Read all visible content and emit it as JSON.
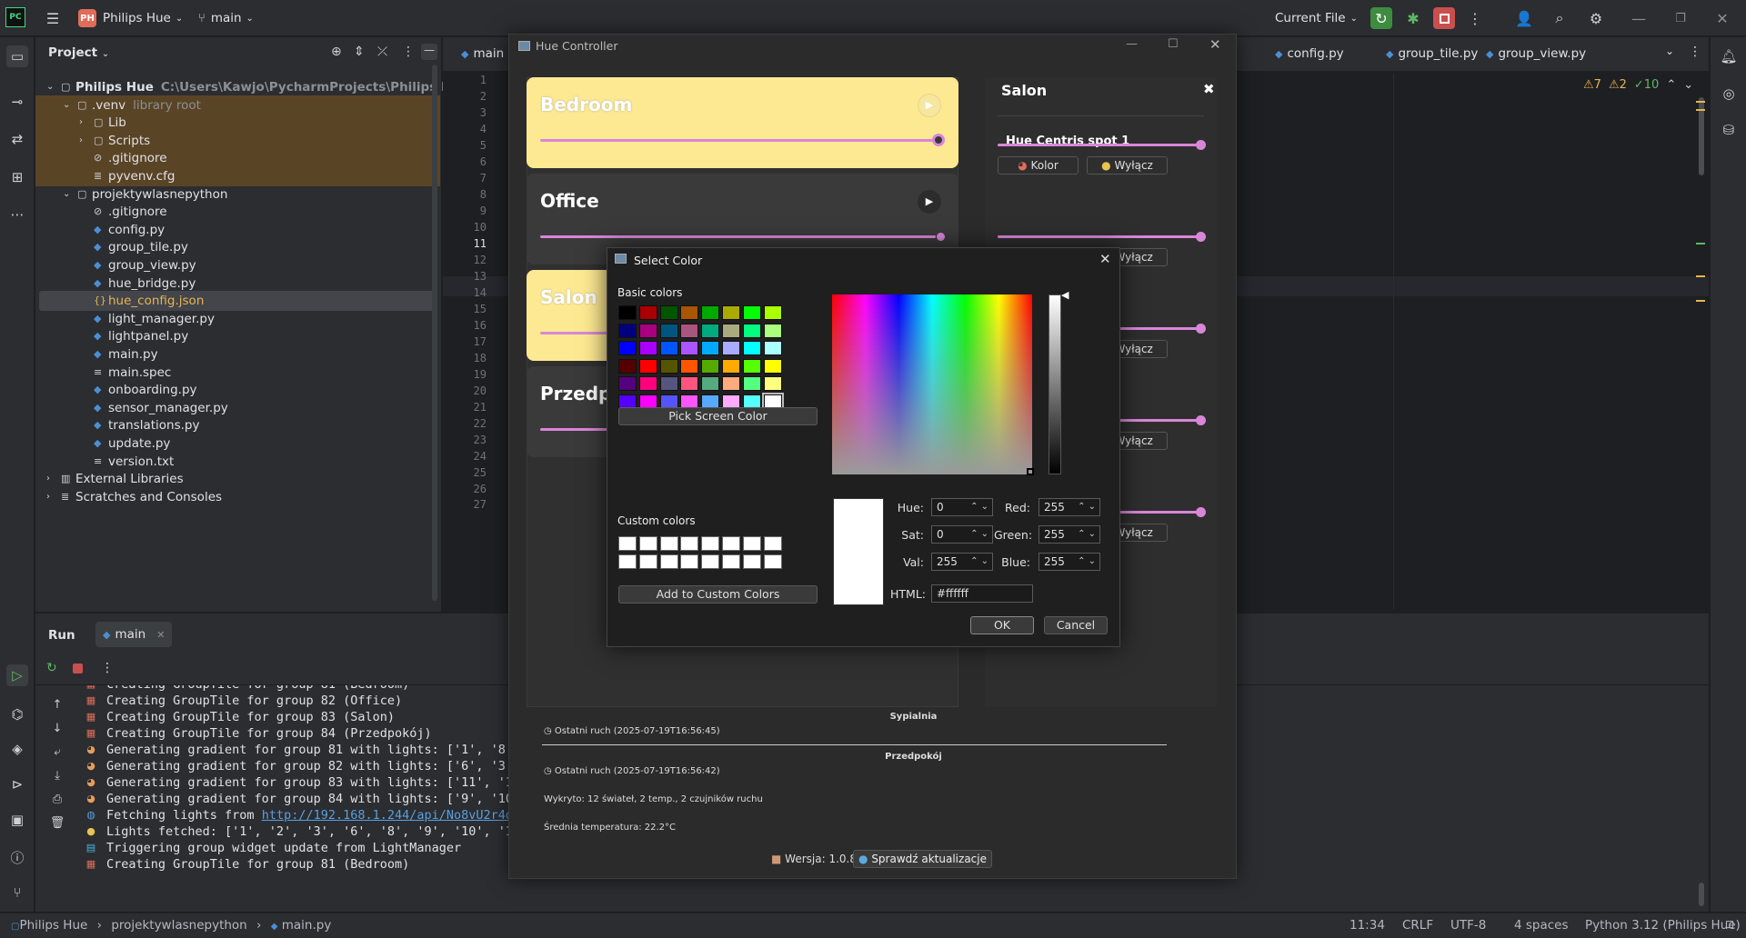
{
  "topbar": {
    "project_badge": "PH",
    "project_name": "Philips Hue",
    "branch": "main",
    "run_config": "Current File"
  },
  "project_panel": {
    "title": "Project",
    "tree": [
      {
        "label": "Philips Hue",
        "hint": "C:\\Users\\Kawjo\\PycharmProjects\\Philips Hue",
        "type": "folder",
        "depth": 0,
        "expanded": true
      },
      {
        "label": ".venv",
        "hint": "library root",
        "type": "folder",
        "depth": 1,
        "expanded": true
      },
      {
        "label": "Lib",
        "hint": "",
        "type": "folder",
        "depth": 2,
        "expanded": false
      },
      {
        "label": "Scripts",
        "hint": "",
        "type": "folder",
        "depth": 2,
        "expanded": false
      },
      {
        "label": ".gitignore",
        "hint": "",
        "type": "ignore",
        "depth": 2
      },
      {
        "label": "pyvenv.cfg",
        "hint": "",
        "type": "cfg",
        "depth": 2
      },
      {
        "label": "projektywlasnepython",
        "hint": "",
        "type": "folder",
        "depth": 1,
        "expanded": true
      },
      {
        "label": ".gitignore",
        "hint": "",
        "type": "ignore",
        "depth": 2
      },
      {
        "label": "config.py",
        "hint": "",
        "type": "py",
        "depth": 2
      },
      {
        "label": "group_tile.py",
        "hint": "",
        "type": "py",
        "depth": 2
      },
      {
        "label": "group_view.py",
        "hint": "",
        "type": "py",
        "depth": 2
      },
      {
        "label": "hue_bridge.py",
        "hint": "",
        "type": "py",
        "depth": 2
      },
      {
        "label": "hue_config.json",
        "hint": "",
        "type": "json",
        "depth": 2,
        "selected": true
      },
      {
        "label": "light_manager.py",
        "hint": "",
        "type": "py",
        "depth": 2
      },
      {
        "label": "lightpanel.py",
        "hint": "",
        "type": "py",
        "depth": 2
      },
      {
        "label": "main.py",
        "hint": "",
        "type": "py",
        "depth": 2
      },
      {
        "label": "main.spec",
        "hint": "",
        "type": "txt",
        "depth": 2
      },
      {
        "label": "onboarding.py",
        "hint": "",
        "type": "py",
        "depth": 2
      },
      {
        "label": "sensor_manager.py",
        "hint": "",
        "type": "py",
        "depth": 2
      },
      {
        "label": "translations.py",
        "hint": "",
        "type": "py",
        "depth": 2
      },
      {
        "label": "update.py",
        "hint": "",
        "type": "py",
        "depth": 2
      },
      {
        "label": "version.txt",
        "hint": "",
        "type": "txt",
        "depth": 2
      },
      {
        "label": "External Libraries",
        "hint": "",
        "type": "lib",
        "depth": 0,
        "expanded": false
      },
      {
        "label": "Scratches and Consoles",
        "hint": "",
        "type": "scratch",
        "depth": 0,
        "expanded": false
      }
    ]
  },
  "editor": {
    "tabs": [
      "main",
      "config.py",
      "group_tile.py",
      "group_view.py"
    ],
    "line_numbers": [
      "1",
      "2",
      "3",
      "4",
      "5",
      "6",
      "7",
      "8",
      "9",
      "10",
      "11",
      "12",
      "13",
      "14",
      "15",
      "16",
      "17",
      "18",
      "19",
      "20",
      "21",
      "22",
      "23",
      "24",
      "25",
      "26",
      "27"
    ],
    "current_line": "11",
    "inspections": {
      "warnings": "7",
      "weak": "2",
      "ok": "10"
    }
  },
  "run_panel": {
    "tab_run": "Run",
    "tab_config": "main",
    "log": [
      {
        "icon": "brick",
        "text": "Creating GroupTile for group 81 (Bedroom)"
      },
      {
        "icon": "brick",
        "text": "Creating GroupTile for group 82 (Office)"
      },
      {
        "icon": "brick",
        "text": "Creating GroupTile for group 83 (Salon)"
      },
      {
        "icon": "brick",
        "text": "Creating GroupTile for group 84 (Przedpokój)"
      },
      {
        "icon": "palette",
        "text": "Generating gradient for group 81 with lights: ['1', '8',"
      },
      {
        "icon": "palette",
        "text": "Generating gradient for group 82 with lights: ['6', '3'"
      },
      {
        "icon": "palette",
        "text": "Generating gradient for group 83 with lights: ['11', '1"
      },
      {
        "icon": "palette",
        "text": "Generating gradient for group 84 with lights: ['9', '10"
      },
      {
        "icon": "globe",
        "text": "Fetching lights from ",
        "link": "http://192.168.1.244/api/No8vU2r4d"
      },
      {
        "icon": "bulb",
        "text": "Lights fetched: ['1', '2', '3', '6', '8', '9', '10', '1"
      },
      {
        "icon": "update",
        "text": "Triggering group widget update from LightManager"
      },
      {
        "icon": "brick",
        "text": "Creating GroupTile for group 81 (Bedroom)"
      }
    ]
  },
  "status_bar": {
    "crumbs": [
      "Philips Hue",
      "projektywlasnepython",
      "main.py"
    ],
    "position": "11:34",
    "line_sep": "CRLF",
    "encoding": "UTF-8",
    "indent": "4 spaces",
    "interpreter": "Python 3.12 (Philips Hue)"
  },
  "hue_window": {
    "title": "Hue Controller",
    "groups": [
      {
        "name": "Bedroom",
        "on": true,
        "brightness": 1.0
      },
      {
        "name": "Office",
        "on": false,
        "brightness": 1.0
      },
      {
        "name": "Salon",
        "on": true,
        "brightness": 1.0
      },
      {
        "name": "Przedpokój",
        "on": false,
        "brightness": 1.0
      }
    ],
    "right_panel": {
      "title": "Salon",
      "close": "✖",
      "light_name": "Hue Centris spot 1",
      "color_button": "Kolor",
      "off_button": "Wyłącz"
    },
    "sensors": {
      "room1": "Sypialnia",
      "motion1": "Ostatni ruch (2025-07-19T16:56:45)",
      "room2": "Przedpokój",
      "motion2": "Ostatni ruch (2025-07-19T16:56:42)",
      "detected": "Wykryto: 12 świateł, 2 temp., 2 czujników ruchu",
      "avg_temp": "Średnia temperatura: 22.2°C"
    },
    "version": "Wersja: 1.0.8",
    "update_button": "Sprawdź aktualizacje"
  },
  "color_dialog": {
    "title": "Select Color",
    "basic_colors_label": "Basic colors",
    "basic_colors": [
      [
        "#000000",
        "#aa0000",
        "#005500",
        "#aa5500",
        "#00aa00",
        "#aaaa00",
        "#00ff00",
        "#aaff00"
      ],
      [
        "#00007f",
        "#aa007f",
        "#00557f",
        "#aa557f",
        "#00aa7f",
        "#aaaa7f",
        "#00ff7f",
        "#aaff7f"
      ],
      [
        "#0000ff",
        "#aa00ff",
        "#0055ff",
        "#aa55ff",
        "#00aaff",
        "#aaaaff",
        "#00ffff",
        "#aaffff"
      ],
      [
        "#550000",
        "#ff0000",
        "#555500",
        "#ff5500",
        "#55aa00",
        "#ffaa00",
        "#55ff00",
        "#ffff00"
      ],
      [
        "#55007f",
        "#ff007f",
        "#55557f",
        "#ff557f",
        "#55aa7f",
        "#ffaa7f",
        "#55ff7f",
        "#ffff7f"
      ],
      [
        "#5500ff",
        "#ff00ff",
        "#5555ff",
        "#ff55ff",
        "#55aaff",
        "#ffaaff",
        "#55ffff",
        "#ffffff"
      ]
    ],
    "pick_screen": "Pick Screen Color",
    "custom_colors_label": "Custom colors",
    "add_custom": "Add to Custom Colors",
    "fields": {
      "hue_label": "Hue:",
      "hue": "0",
      "sat_label": "Sat:",
      "sat": "0",
      "val_label": "Val:",
      "val": "255",
      "red_label": "Red:",
      "red": "255",
      "green_label": "Green:",
      "green": "255",
      "blue_label": "Blue:",
      "blue": "255",
      "html_label": "HTML:",
      "html": "#ffffff"
    },
    "ok": "OK",
    "cancel": "Cancel",
    "current_color": "#ffffff"
  },
  "colors": {
    "tile_on": "#fde992",
    "tile_off": "#3a3a3a",
    "slider": "#d986d9",
    "venv_bg": "#5a4426",
    "accent": "#3574f0"
  }
}
